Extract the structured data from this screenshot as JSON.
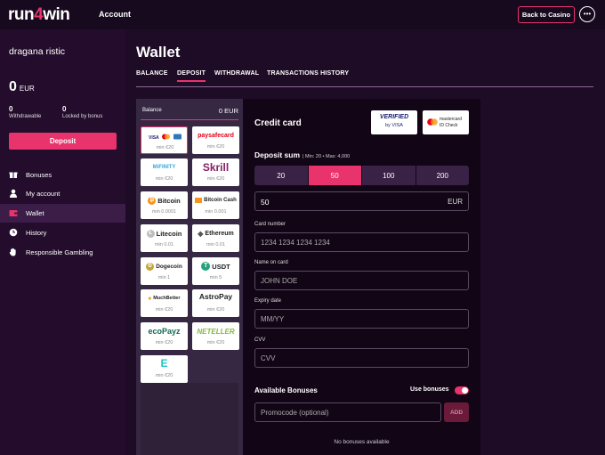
{
  "header": {
    "logo_prefix": "run",
    "logo_four": "4",
    "logo_suffix": "win",
    "nav_account": "Account",
    "back_button": "Back to Casino",
    "more_icon": "ellipsis-icon",
    "accent_color": "#e8336c"
  },
  "sidebar": {
    "username": "dragana ristic",
    "balance": "0",
    "balance_currency": "EUR",
    "withdrawable_value": "0",
    "withdrawable_label": "Withdrawable",
    "locked_value": "0",
    "locked_label": "Locked by bonus",
    "deposit_button": "Deposit",
    "menu": [
      {
        "label": "Bonuses",
        "icon": "gift-icon"
      },
      {
        "label": "My account",
        "icon": "user-icon"
      },
      {
        "label": "Wallet",
        "icon": "wallet-icon",
        "active": true
      },
      {
        "label": "History",
        "icon": "clock-icon"
      },
      {
        "label": "Responsible Gambling",
        "icon": "hand-icon"
      }
    ]
  },
  "main": {
    "title": "Wallet",
    "tabs": [
      {
        "label": "BALANCE"
      },
      {
        "label": "DEPOSIT",
        "active": true
      },
      {
        "label": "WITHDRAWAL"
      },
      {
        "label": "TRANSACTIONS HISTORY"
      }
    ]
  },
  "methods": {
    "balance_label": "Balance",
    "balance_value": "0 EUR",
    "items": [
      {
        "name": "VISA · MC",
        "min": "min €20",
        "selected": true
      },
      {
        "name": "paysafecard",
        "min": "min €20"
      },
      {
        "name": "MiFINITY",
        "min": "min €20"
      },
      {
        "name": "Skrill",
        "min": "min €20"
      },
      {
        "name": "Bitcoin",
        "min": "min 0.0001"
      },
      {
        "name": "Bitcoin Cash",
        "min": "min 0.001"
      },
      {
        "name": "Litecoin",
        "min": "min 0.01"
      },
      {
        "name": "Ethereum",
        "min": "min 0.01"
      },
      {
        "name": "Dogecoin",
        "min": "min 1"
      },
      {
        "name": "USDT",
        "min": "min 5"
      },
      {
        "name": "MuchBetter",
        "min": "min €20"
      },
      {
        "name": "AstroPay",
        "min": "min €20"
      },
      {
        "name": "ecoPayz",
        "min": "min €20"
      },
      {
        "name": "NETELLER",
        "min": "min €20"
      },
      {
        "name": "E",
        "min": "min €20"
      }
    ]
  },
  "form": {
    "title": "Credit card",
    "visa_badge_top": "VERIFIED",
    "visa_badge_bottom": "by VISA",
    "mc_badge_top": "mastercard",
    "mc_badge_bottom": "ID Check",
    "deposit_sum_label": "Deposit sum",
    "min_max": "| Min: 20 • Max: 4,000",
    "amounts": [
      "20",
      "50",
      "100",
      "200"
    ],
    "selected_amount_index": 1,
    "amount_value": "50",
    "amount_currency": "EUR",
    "card_number_label": "Card number",
    "card_number_placeholder": "1234 1234 1234 1234",
    "name_label": "Name on card",
    "name_placeholder": "JOHN DOE",
    "expiry_label": "Expiry date",
    "expiry_placeholder": "MM/YY",
    "cvv_label": "CVV",
    "cvv_placeholder": "CVV",
    "bonuses_title": "Available Bonuses",
    "use_bonuses_label": "Use bonuses",
    "use_bonuses_on": true,
    "promo_placeholder": "Promocode (optional)",
    "add_button": "ADD",
    "no_bonuses": "No bonuses available"
  }
}
